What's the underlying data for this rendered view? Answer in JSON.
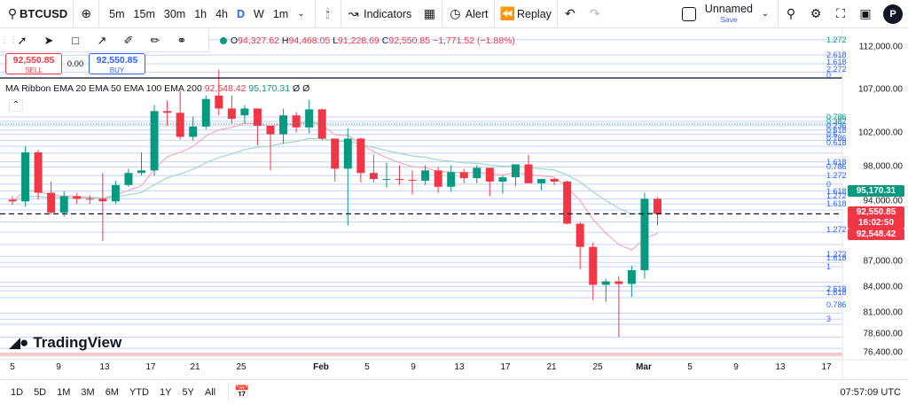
{
  "toolbar": {
    "symbol": "BTCUSD",
    "intervals": [
      "5m",
      "15m",
      "30m",
      "1h",
      "4h",
      "D",
      "W",
      "1m"
    ],
    "active_interval": "D",
    "indicators_label": "Indicators",
    "alert_label": "Alert",
    "replay_label": "Replay",
    "layout_name": "Unnamed",
    "save_label": "Save",
    "avatar_letter": "P"
  },
  "drawing_tools": [
    "trend-line-icon",
    "cursor-icon",
    "rectangle-icon",
    "arrow-icon",
    "brush-icon",
    "pencil-icon",
    "link-icon"
  ],
  "ohlc": {
    "o_label": "O",
    "o": "94,327.62",
    "h_label": "H",
    "h": "94,468.05",
    "l_label": "L",
    "l": "91,228.69",
    "c_label": "C",
    "c": "92,550.85",
    "change": "−1,771.52 (−1.88%)"
  },
  "trade": {
    "sell_price": "92,550.85",
    "sell_label": "SELL",
    "spread": "0.00",
    "buy_price": "92,550.85",
    "buy_label": "BUY"
  },
  "ma_legend": {
    "name": "MA Ribbon EMA 20 EMA 50 EMA 100 EMA 200",
    "v1": "92,548.42",
    "v2": "95,170.31",
    "v3": "Ø",
    "v4": "Ø"
  },
  "price_axis": {
    "ticks": [
      "112,000.00",
      "107,000.00",
      "102,000.00",
      "98,000.00",
      "94,000.00",
      "90,000.00",
      "87,000.00",
      "84,000.00",
      "81,000.00",
      "78,600.00",
      "76,400.00"
    ],
    "tags": {
      "ema50": "95,170.31",
      "last_price": "92,550.85",
      "countdown": "16:02:50",
      "ema20": "92,548.42"
    }
  },
  "fib_labels": [
    "1.272",
    "2.618",
    "1.618",
    "2.272",
    "0",
    "0.786",
    "0.382",
    "0.236",
    "0.618",
    "0.5",
    "0.786",
    "0.618",
    "1.618",
    "0.786",
    "1.272",
    "0",
    "1.618",
    "1.272",
    "1.618",
    "1.272",
    "1.272",
    "1.618",
    "1",
    "2.618",
    "1.618",
    "0.786",
    "3"
  ],
  "colors": {
    "up": "#089981",
    "down": "#f23645",
    "ema20": "#f7a8b8",
    "ema50": "#9ed9c4",
    "fib": "#2962ff",
    "fib_green": "#089981",
    "accent": "#2962ff"
  },
  "x_axis": [
    "5",
    "9",
    "13",
    "17",
    "21",
    "25",
    "Feb",
    "5",
    "9",
    "13",
    "17",
    "21",
    "25",
    "Mar",
    "5",
    "9",
    "13",
    "17"
  ],
  "bottom": {
    "ranges": [
      "1D",
      "5D",
      "1M",
      "3M",
      "6M",
      "YTD",
      "1Y",
      "5Y",
      "All"
    ],
    "time": "07:57:09 UTC"
  },
  "logo_text": "TradingView",
  "chart_data": {
    "type": "candlestick",
    "series": [
      {
        "name": "BTCUSD",
        "ohlc": [
          [
            94200,
            94600,
            93600,
            94000
          ],
          [
            94000,
            100400,
            93400,
            99700
          ],
          [
            99700,
            100000,
            94200,
            95000
          ],
          [
            95000,
            96300,
            92500,
            92700
          ],
          [
            92700,
            95200,
            92200,
            94600
          ],
          [
            94600,
            95000,
            93700,
            94300
          ],
          [
            94300,
            94700,
            93700,
            94200
          ],
          [
            94300,
            97300,
            89400,
            94000
          ],
          [
            94000,
            96400,
            93700,
            95900
          ],
          [
            95900,
            97800,
            95700,
            97300
          ],
          [
            97300,
            99700,
            97000,
            97600
          ],
          [
            97600,
            105200,
            97000,
            104500
          ],
          [
            104500,
            105700,
            102800,
            104300
          ],
          [
            104300,
            106900,
            101200,
            101500
          ],
          [
            101500,
            103900,
            101100,
            102700
          ],
          [
            102700,
            106300,
            102400,
            105900
          ],
          [
            106300,
            109300,
            104000,
            104800
          ],
          [
            104800,
            106300,
            103000,
            103600
          ],
          [
            104000,
            105200,
            103100,
            104800
          ],
          [
            104800,
            104500,
            100500,
            102800
          ],
          [
            102800,
            102500,
            97600,
            101800
          ],
          [
            101800,
            104800,
            100700,
            104000
          ],
          [
            104000,
            104400,
            102000,
            102600
          ],
          [
            102600,
            105800,
            101900,
            104700
          ],
          [
            104700,
            104800,
            101100,
            101300
          ],
          [
            101300,
            101300,
            96300,
            97800
          ],
          [
            97800,
            102500,
            91200,
            101300
          ],
          [
            101300,
            101400,
            96200,
            97300
          ],
          [
            97300,
            99400,
            96200,
            96600
          ],
          [
            96600,
            98500,
            95600,
            96600
          ],
          [
            96600,
            98200,
            95900,
            96500
          ],
          [
            96500,
            97600,
            94800,
            96400
          ],
          [
            96400,
            98200,
            95900,
            97600
          ],
          [
            97600,
            98000,
            95000,
            95700
          ],
          [
            95700,
            98200,
            95100,
            97400
          ],
          [
            97400,
            97800,
            96100,
            96700
          ],
          [
            96700,
            98200,
            96100,
            97900
          ],
          [
            97900,
            97900,
            94600,
            96300
          ],
          [
            96300,
            97000,
            94900,
            96800
          ],
          [
            96800,
            98300,
            95800,
            98300
          ],
          [
            98300,
            99400,
            96300,
            96100
          ],
          [
            96100,
            96600,
            95300,
            96600
          ],
          [
            96600,
            96700,
            95900,
            96300
          ],
          [
            96300,
            96400,
            91300,
            91400
          ],
          [
            91400,
            91600,
            86100,
            88700
          ],
          [
            88700,
            89200,
            82500,
            84300
          ],
          [
            84300,
            85000,
            82300,
            84700
          ],
          [
            84700,
            85300,
            78200,
            84400
          ],
          [
            84400,
            86500,
            82900,
            86000
          ],
          [
            86000,
            95000,
            85000,
            94300
          ],
          [
            94300,
            94500,
            91200,
            92550
          ]
        ]
      }
    ],
    "ema20_label": "EMA 20",
    "ema50_label": "EMA 50",
    "ylim": [
      76000,
      113500
    ],
    "ticks": [
      112000,
      107000,
      102000,
      98000,
      94000,
      90000,
      87000,
      84000,
      81000,
      78600,
      76400
    ]
  }
}
